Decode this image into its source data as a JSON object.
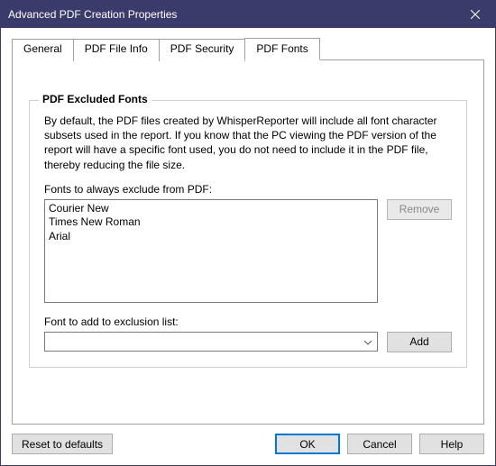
{
  "window": {
    "title": "Advanced PDF Creation Properties"
  },
  "tabs": {
    "general": "General",
    "fileinfo": "PDF File Info",
    "security": "PDF Security",
    "fonts": "PDF Fonts"
  },
  "group": {
    "title": "PDF Excluded Fonts",
    "description": "By default, the PDF files created by WhisperReporter will include all font character subsets used in the report.  If you know that the PC viewing the PDF version of the report will have a specific font used, you do not need to include it in the PDF file, thereby reducing the file size.",
    "list_label": "Fonts to always exclude from PDF:",
    "add_label": "Font to add to exclusion list:",
    "remove_btn": "Remove",
    "add_btn": "Add",
    "items": {
      "0": "Courier New",
      "1": "Times New Roman",
      "2": "Arial"
    }
  },
  "footer": {
    "reset": "Reset to defaults",
    "ok": "OK",
    "cancel": "Cancel",
    "help": "Help"
  }
}
